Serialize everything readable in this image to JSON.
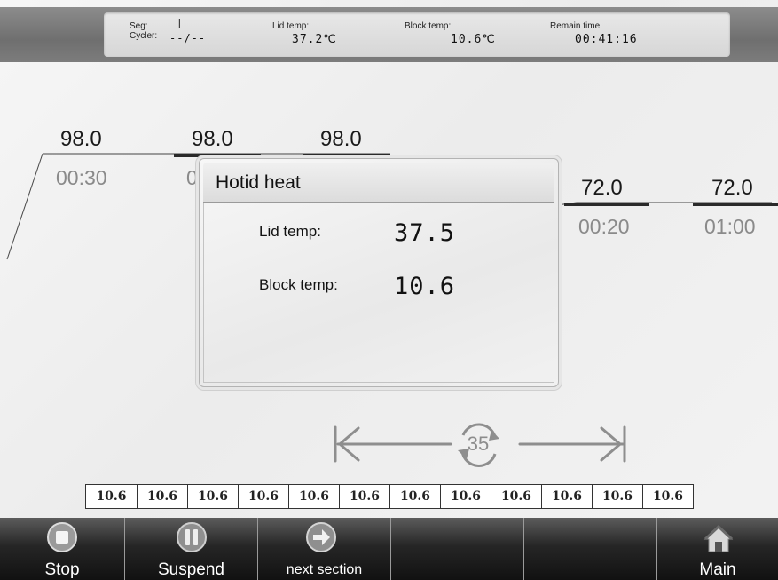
{
  "status_bar": {
    "seg_label": "Seg:",
    "seg_value": "|",
    "cycler_label": "Cycler:",
    "cycler_value": "--/--",
    "lid_label": "Lid temp:",
    "lid_value": "37.2℃",
    "block_label": "Block temp:",
    "block_value": "10.6℃",
    "remain_label": "Remain time:",
    "remain_value": "00:41:16"
  },
  "profile": {
    "steps": [
      {
        "temp": "98.0",
        "time": "00:30"
      },
      {
        "temp": "98.0",
        "time": "0"
      },
      {
        "temp": "98.0",
        "time": ""
      },
      {
        "temp": "72.0",
        "time": "00:20"
      },
      {
        "temp": "72.0",
        "time": "01:00"
      }
    ],
    "cycles": "35"
  },
  "dialog": {
    "title": "Hotid heat",
    "lid_label": "Lid temp:",
    "lid_value": "37.5",
    "block_label": "Block temp:",
    "block_value": "10.6"
  },
  "block_temps": [
    "10.6",
    "10.6",
    "10.6",
    "10.6",
    "10.6",
    "10.6",
    "10.6",
    "10.6",
    "10.6",
    "10.6",
    "10.6",
    "10.6"
  ],
  "toolbar": {
    "stop": "Stop",
    "suspend": "Suspend",
    "next_section": "next section",
    "main": "Main"
  },
  "icons": [
    "stop-icon",
    "pause-icon",
    "next-arrow-icon",
    "home-icon",
    "cycle-icon",
    "arrow-left-icon",
    "arrow-right-icon"
  ],
  "colors": {
    "toolbar_bg": "#1a1a1a",
    "topbar_bg": "#7a7a7a",
    "step_bar": "#333333"
  }
}
